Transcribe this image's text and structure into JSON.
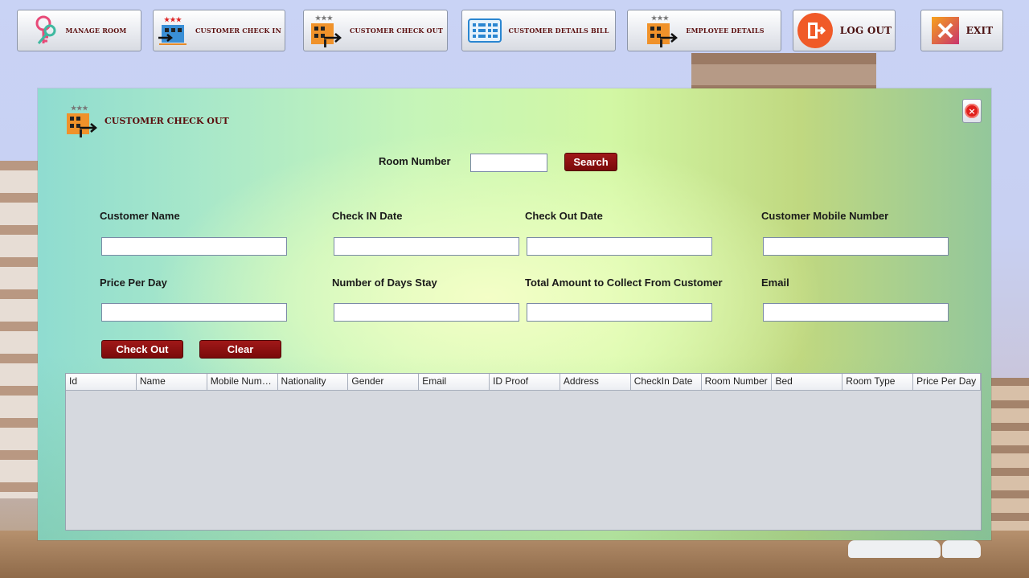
{
  "toolbar": {
    "manage_room": "MANAGE ROOM",
    "customer_check_in": "CUSTOMER CHECK IN",
    "customer_check_out": "CUSTOMER CHECK OUT",
    "customer_details_bill": "CUSTOMER DETAILS BILL",
    "employee_details": "EMPLOYEE DETAILS",
    "log_out": "LOG OUT",
    "exit": "EXIT"
  },
  "panel": {
    "title": "CUSTOMER CHECK OUT",
    "room_number_label": "Room Number",
    "room_number_value": "",
    "search_label": "Search",
    "fields": {
      "customer_name": "Customer Name",
      "check_in_date": "Check IN Date",
      "check_out_date": "Check Out Date",
      "customer_mobile": "Customer Mobile Number",
      "price_per_day": "Price Per Day",
      "num_days": "Number of Days Stay",
      "total_amount": "Total Amount to Collect From Customer",
      "email": "Email"
    },
    "check_out_label": "Check Out",
    "clear_label": "Clear"
  },
  "table": {
    "columns": [
      "Id",
      "Name",
      "Mobile Numb...",
      "Nationality",
      "Gender",
      "Email",
      "ID Proof",
      "Address",
      "CheckIn Date",
      "Room Number",
      "Bed",
      "Room Type",
      "Price Per Day"
    ],
    "rows": []
  },
  "icons": {
    "manage_room": "key-icon",
    "check_in": "hotel-checkin-icon",
    "check_out": "hotel-checkout-icon",
    "bill": "bill-list-icon",
    "employee": "hotel-employee-icon",
    "logout": "logout-door-icon",
    "exit": "exit-x-icon",
    "close": "close-icon"
  },
  "colors": {
    "accent_dark_red": "#8b0f0f",
    "label_maroon": "#5b0e0e"
  }
}
